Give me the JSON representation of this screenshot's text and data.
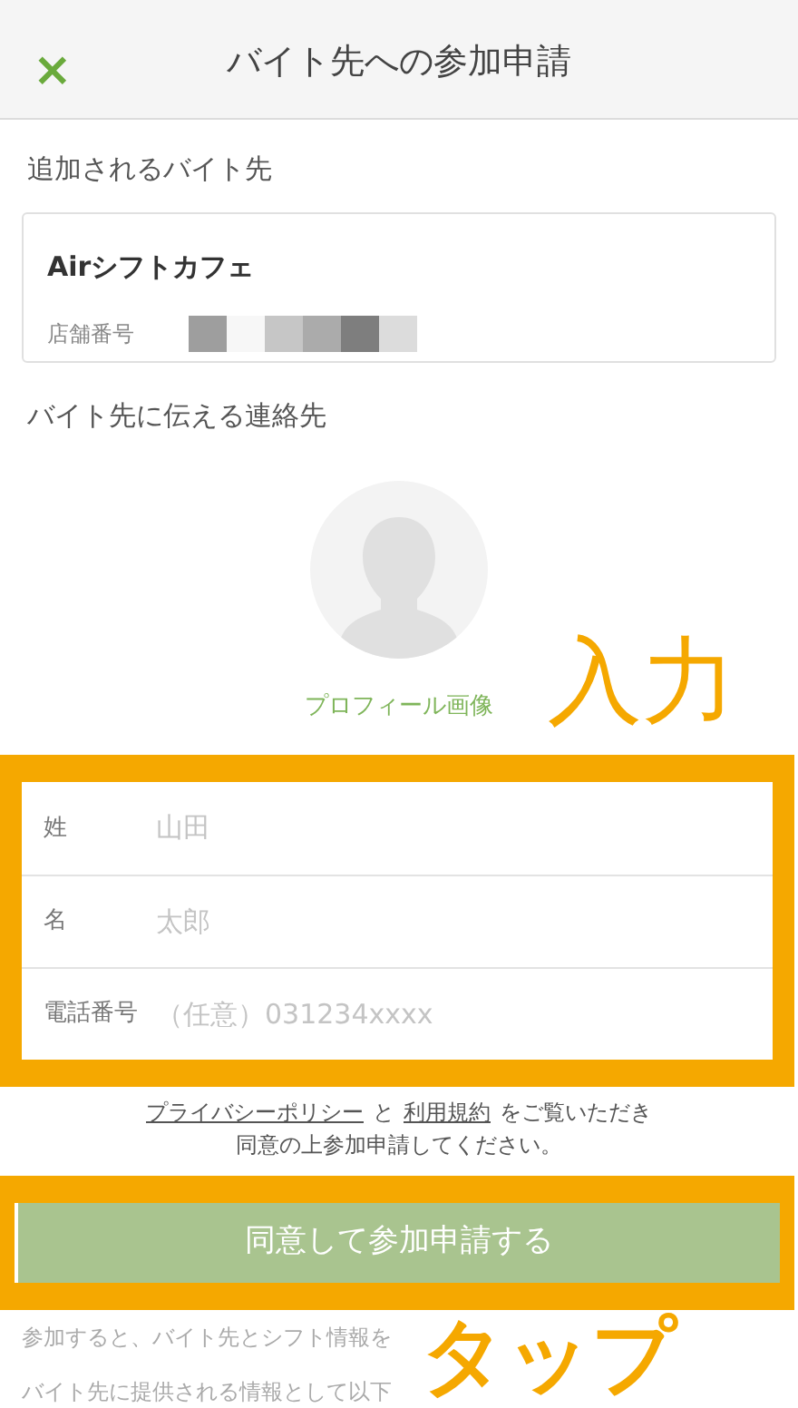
{
  "header": {
    "close_icon": "×",
    "title": "バイト先への参加申請"
  },
  "workplace": {
    "heading": "追加されるバイト先",
    "name": "Airシフトカフェ",
    "number_label": "店舗番号"
  },
  "contact": {
    "heading": "バイト先に伝える連絡先",
    "avatar_label": "プロフィール画像"
  },
  "fields": [
    {
      "label": "姓",
      "placeholder": "山田"
    },
    {
      "label": "名",
      "placeholder": "太郎"
    },
    {
      "label": "電話番号",
      "placeholder": "（任意）031234xxxx"
    }
  ],
  "consent": {
    "links": [
      "プライバシーポリシー",
      "利用規約"
    ],
    "joiner": "と",
    "line1_rest": "をご覧いただき",
    "line2": "同意の上参加申請してください。"
  },
  "submit": {
    "label": "同意して参加申請する",
    "disabled": true
  },
  "notes": [
    "参加すると、バイト先とシフト情報を",
    "バイト先に提供される情報として以下"
  ],
  "annotations": {
    "input": "入力",
    "tap": "タップ"
  }
}
